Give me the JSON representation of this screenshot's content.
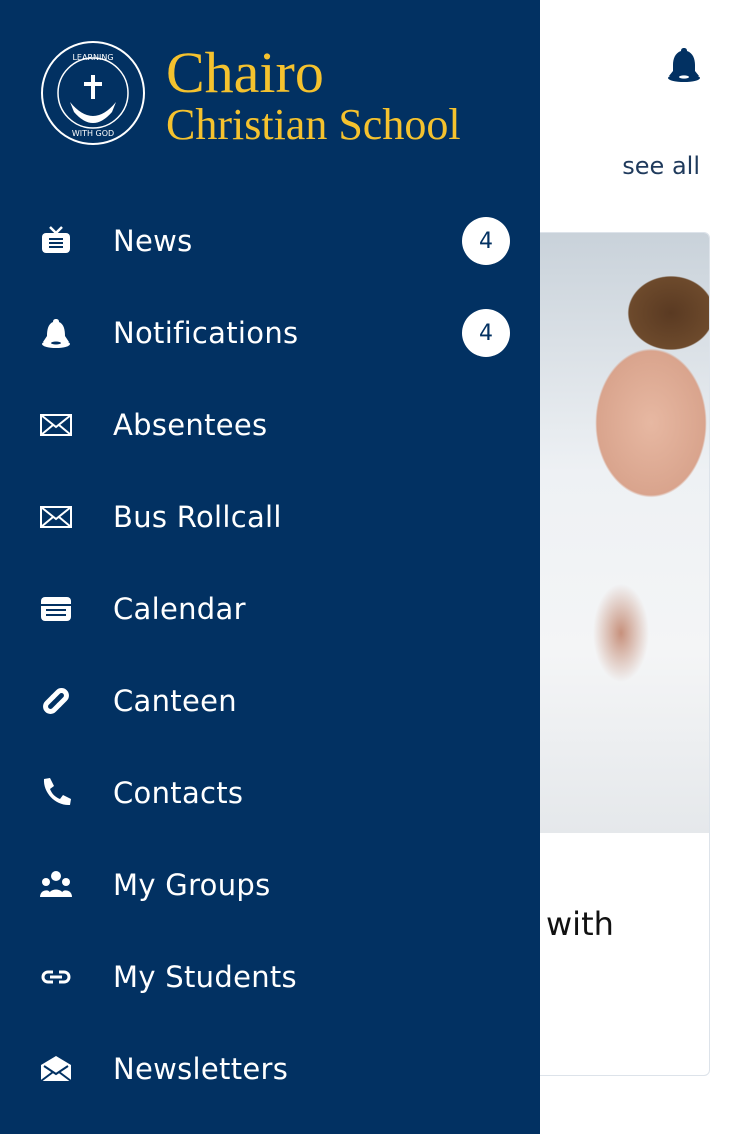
{
  "header": {
    "bell_icon": "bell-icon",
    "see_all_label": "see all"
  },
  "card": {
    "title_fragment": "with"
  },
  "drawer": {
    "logo": {
      "seal_top_text": "LEARNING",
      "seal_bottom_text": "WITH GOD",
      "line1": "Chairo",
      "line2": "Christian School"
    },
    "colors": {
      "background": "#023162",
      "logo": "#f5c22e"
    },
    "items": [
      {
        "label": "News",
        "icon": "tv-icon",
        "badge": "4"
      },
      {
        "label": "Notifications",
        "icon": "bell-icon",
        "badge": "4"
      },
      {
        "label": "Absentees",
        "icon": "envelope-icon"
      },
      {
        "label": "Bus Rollcall",
        "icon": "envelope-icon"
      },
      {
        "label": "Calendar",
        "icon": "calendar-icon"
      },
      {
        "label": "Canteen",
        "icon": "link-icon"
      },
      {
        "label": "Contacts",
        "icon": "phone-icon"
      },
      {
        "label": "My Groups",
        "icon": "group-icon"
      },
      {
        "label": "My Students",
        "icon": "link-icon"
      },
      {
        "label": "Newsletters",
        "icon": "envelope-open-icon"
      }
    ]
  }
}
